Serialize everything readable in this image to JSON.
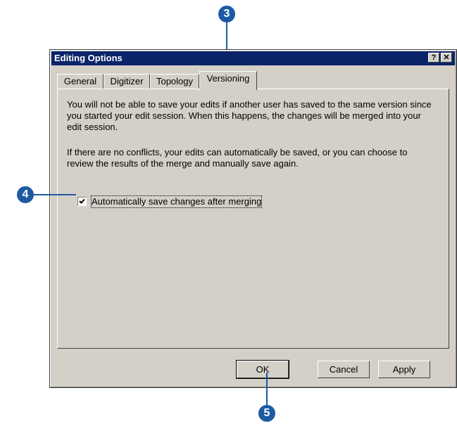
{
  "dialog": {
    "title": "Editing Options",
    "help_button": "?",
    "close_button": "✕"
  },
  "tabs": [
    {
      "label": "General",
      "active": false
    },
    {
      "label": "Digitizer",
      "active": false
    },
    {
      "label": "Topology",
      "active": false
    },
    {
      "label": "Versioning",
      "active": true
    }
  ],
  "content": {
    "paragraph1": "You will not be able to save your edits if another user has saved to the same version since you started your edit session. When this happens, the changes will be merged into your edit session.",
    "paragraph2": "If there are no conflicts, your edits can automatically be saved, or you can choose to review the results of the merge and manually save again.",
    "checkbox_label": "Automatically save changes after merging",
    "checkbox_checked": true
  },
  "buttons": {
    "ok": "OK",
    "cancel": "Cancel",
    "apply": "Apply"
  },
  "callouts": {
    "c3": "3",
    "c4": "4",
    "c5": "5"
  },
  "colors": {
    "callout": "#1d5aa3",
    "titlebar": "#0a246a",
    "dialog_face": "#d4d0c8"
  }
}
